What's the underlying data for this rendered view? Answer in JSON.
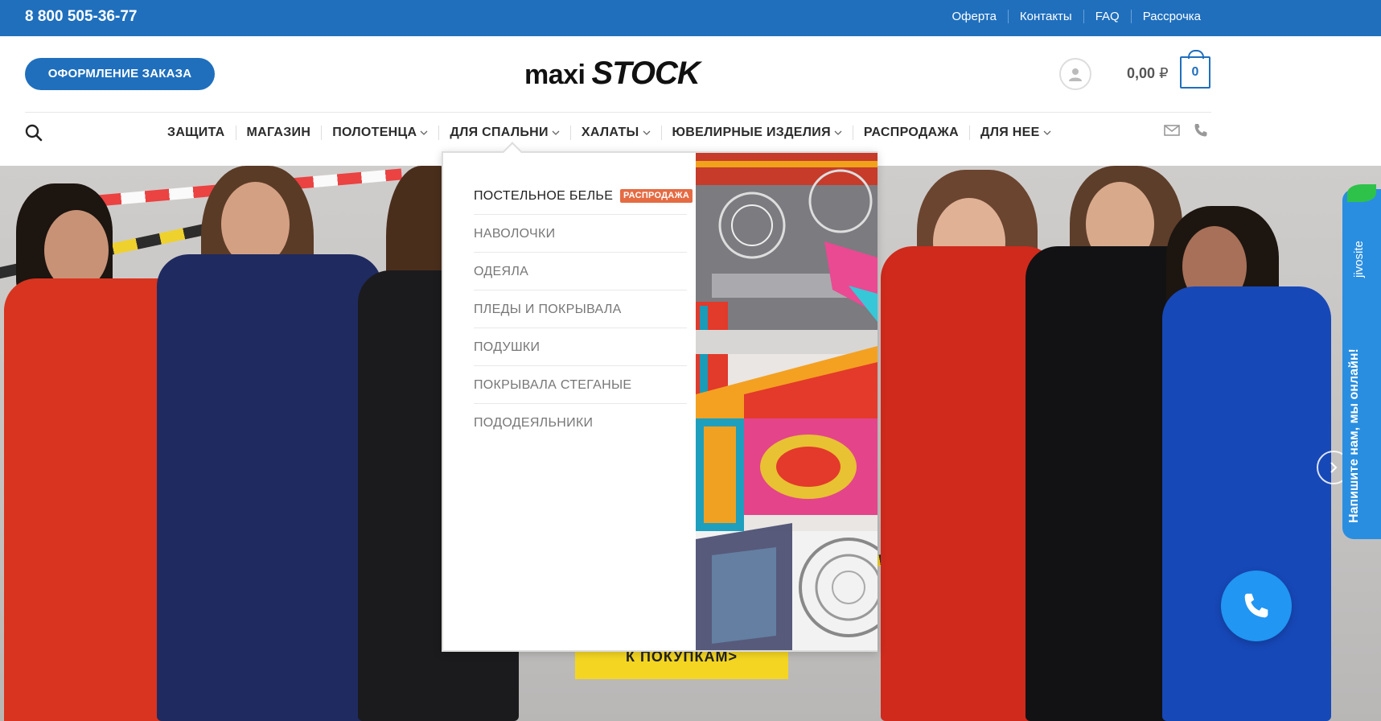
{
  "topbar": {
    "phone": "8 800 505-36-77",
    "links": [
      "Оферта",
      "Контакты",
      "FAQ",
      "Рассрочка"
    ]
  },
  "header": {
    "order_button": "ОФОРМЛЕНИЕ ЗАКАЗА",
    "logo_part1": "maxi",
    "logo_part2": "STOCK",
    "cart_total": "0,00",
    "currency": "₽",
    "cart_count": "0"
  },
  "nav": {
    "items": [
      {
        "label": "ЗАЩИТА",
        "has_dropdown": false
      },
      {
        "label": "МАГАЗИН",
        "has_dropdown": false
      },
      {
        "label": "ПОЛОТЕНЦА",
        "has_dropdown": true
      },
      {
        "label": "ДЛЯ СПАЛЬНИ",
        "has_dropdown": true
      },
      {
        "label": "ХАЛАТЫ",
        "has_dropdown": true
      },
      {
        "label": "ЮВЕЛИРНЫЕ ИЗДЕЛИЯ",
        "has_dropdown": true
      },
      {
        "label": "РАСПРОДАЖА",
        "has_dropdown": false
      },
      {
        "label": "ДЛЯ НЕЕ",
        "has_dropdown": true
      }
    ]
  },
  "dropdown": {
    "heading": "ПОСТЕЛЬНОЕ БЕЛЬЕ",
    "badge": "РАСПРОДАЖА",
    "items": [
      "НАВОЛОЧКИ",
      "ОДЕЯЛА",
      "ПЛЕДЫ И ПОКРЫВАЛА",
      "ПОДУШКИ",
      "ПОКРЫВАЛА СТЕГАНЫЕ",
      "ПОДОДЕЯЛЬНИКИ"
    ]
  },
  "hero": {
    "cta": "К ПОКУПКАМ>"
  },
  "chat": {
    "brand": "jivosite",
    "text": "Напишите нам, мы онлайн!"
  },
  "colors": {
    "brand_blue": "#1f6fbd",
    "sale_badge": "#e56b43",
    "cta_yellow": "#f4d622",
    "chat_blue": "#2a8ee0"
  }
}
